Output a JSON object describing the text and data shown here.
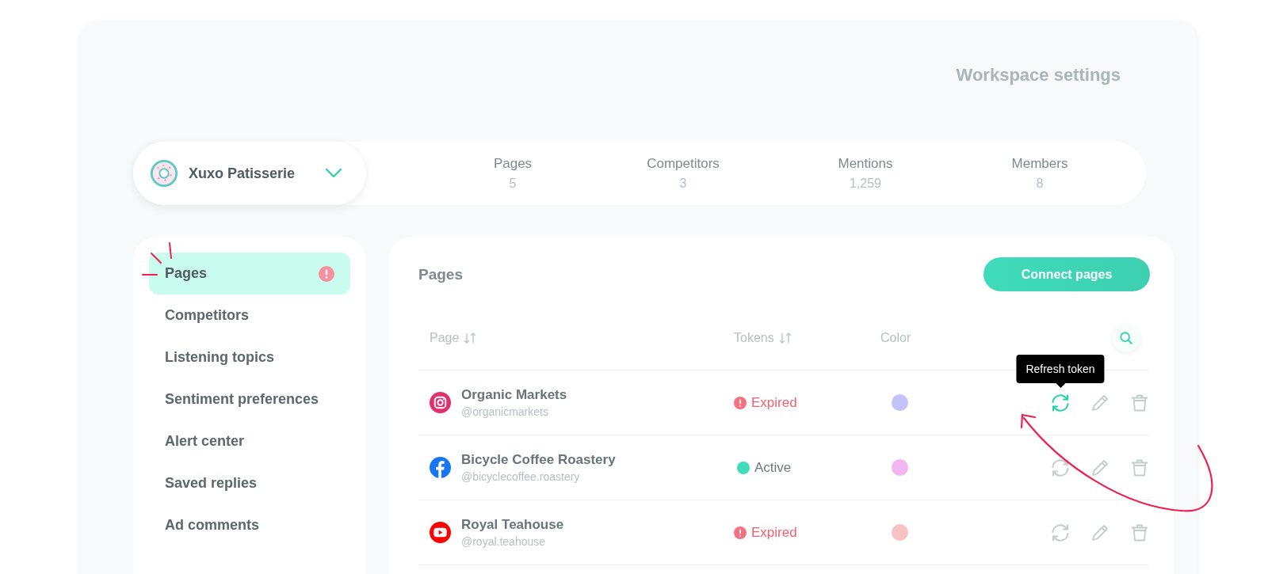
{
  "title": "Workspace settings",
  "workspace": {
    "name": "Xuxo Patisserie"
  },
  "stats": [
    {
      "label": "Pages",
      "value": "5"
    },
    {
      "label": "Competitors",
      "value": "3"
    },
    {
      "label": "Mentions",
      "value": "1,259"
    },
    {
      "label": "Members",
      "value": "8"
    }
  ],
  "sidebar": {
    "items": [
      {
        "label": "Pages",
        "selected": true,
        "alert": true
      },
      {
        "label": "Competitors",
        "selected": false,
        "alert": false
      },
      {
        "label": "Listening topics",
        "selected": false,
        "alert": false
      },
      {
        "label": "Sentiment preferences",
        "selected": false,
        "alert": false
      },
      {
        "label": "Alert center",
        "selected": false,
        "alert": false
      },
      {
        "label": "Saved replies",
        "selected": false,
        "alert": false
      },
      {
        "label": "Ad comments",
        "selected": false,
        "alert": false
      }
    ]
  },
  "panel": {
    "title": "Pages",
    "button": "Connect pages",
    "columns": [
      {
        "label": "Page",
        "sortable": true
      },
      {
        "label": "Tokens",
        "sortable": true
      },
      {
        "label": "Color",
        "sortable": false
      }
    ],
    "rows": [
      {
        "kind": "instagram",
        "name": "Organic Markets",
        "handle": "@organicmarkets",
        "token": {
          "kind": "expired",
          "label": "Expired"
        },
        "color": "#c3c3fb",
        "refresh_active": true,
        "tooltip": "Refresh token"
      },
      {
        "kind": "facebook",
        "name": "Bicycle Coffee Roastery",
        "handle": "@bicyclecoffee.roastery",
        "token": {
          "kind": "active",
          "label": "Active"
        },
        "color": "#f1b6f0",
        "refresh_active": false
      },
      {
        "kind": "youtube",
        "name": "Royal Teahouse",
        "handle": "@royal.teahouse",
        "token": {
          "kind": "expired",
          "label": "Expired"
        },
        "color": "#f6c2c2",
        "refresh_active": false
      }
    ]
  }
}
